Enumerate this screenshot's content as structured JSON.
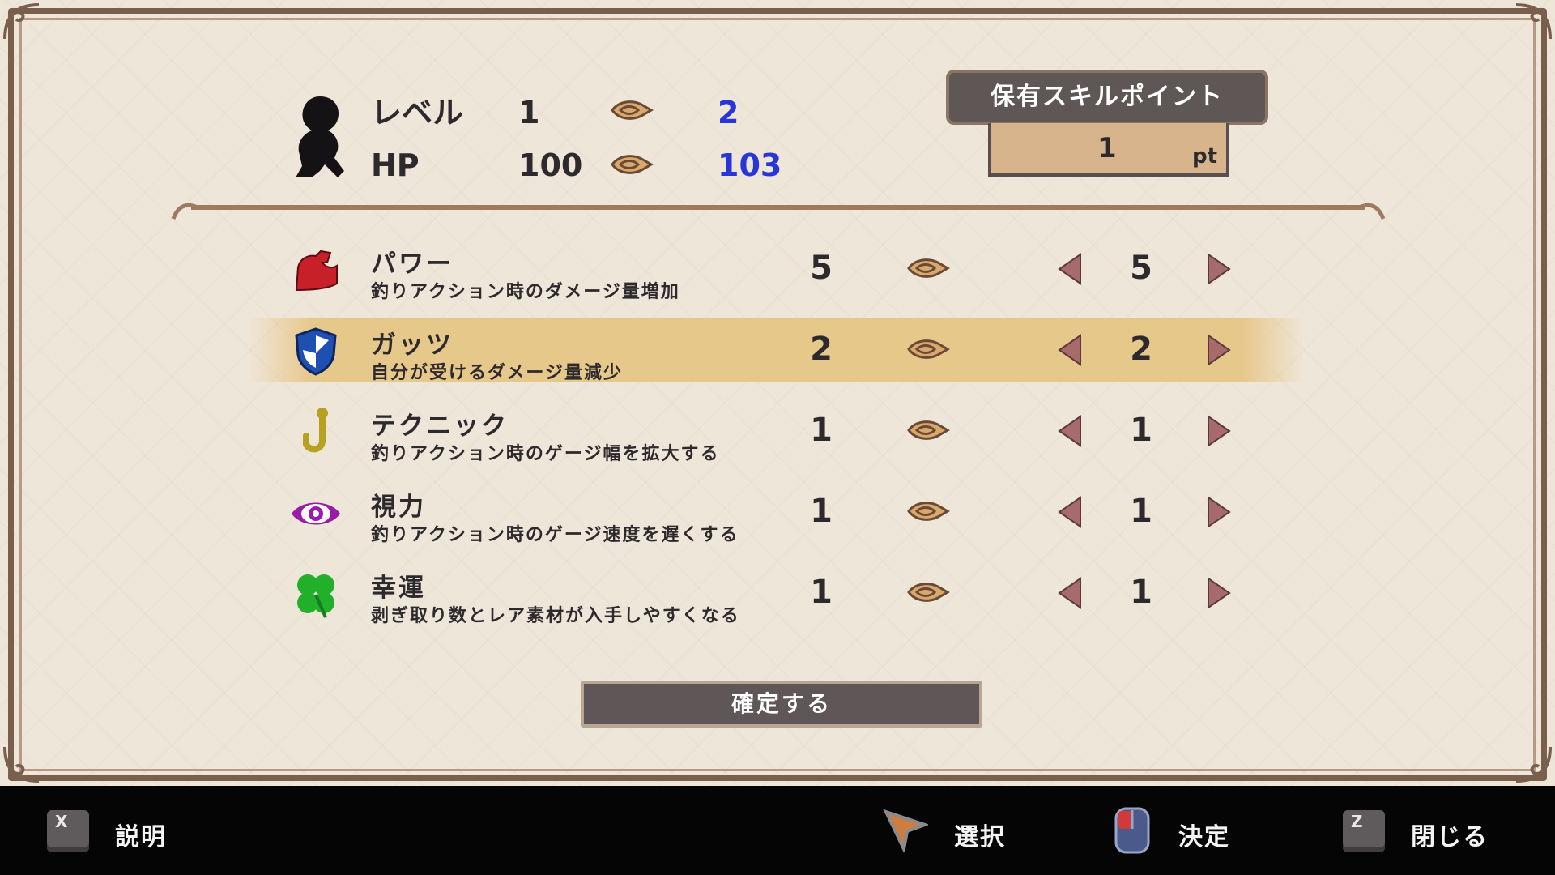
{
  "header": {
    "level_label": "レベル",
    "level_current": "1",
    "level_next": "2",
    "hp_label": "HP",
    "hp_current": "100",
    "hp_next": "103"
  },
  "skill_points": {
    "title": "保有スキルポイント",
    "value": "1",
    "unit": "pt"
  },
  "skills": [
    {
      "icon": "muscle-arm-icon",
      "name": "パワー",
      "desc": "釣りアクション時のダメージ量増加",
      "current": "5",
      "next": "5"
    },
    {
      "icon": "shield-icon",
      "name": "ガッツ",
      "desc": "自分が受けるダメージ量減少",
      "current": "2",
      "next": "2",
      "selected": true
    },
    {
      "icon": "fishhook-icon",
      "name": "テクニック",
      "desc": "釣りアクション時のゲージ幅を拡大する",
      "current": "1",
      "next": "1"
    },
    {
      "icon": "eye-icon",
      "name": "視力",
      "desc": "釣りアクション時のゲージ速度を遅くする",
      "current": "1",
      "next": "1"
    },
    {
      "icon": "clover-icon",
      "name": "幸運",
      "desc": "剥ぎ取り数とレア素材が入手しやすくなる",
      "current": "1",
      "next": "1"
    }
  ],
  "confirm_label": "確定する",
  "controls": {
    "explain_key": "X",
    "explain_label": "説明",
    "select_label": "選択",
    "decide_label": "決定",
    "close_key": "Z",
    "close_label": "閉じる"
  },
  "colors": {
    "parchment": "#efe6da",
    "frame": "#7a5f4d",
    "highlight": "#e7c88b",
    "new_value_blue": "#2836d8",
    "arrow_button": "#a76b6b"
  }
}
